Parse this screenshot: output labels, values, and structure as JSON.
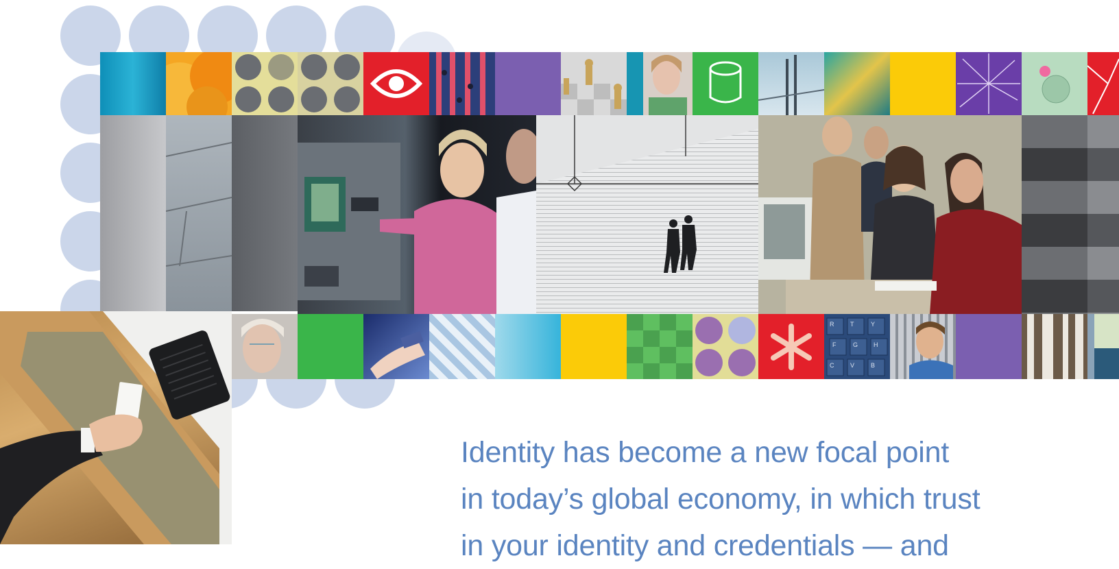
{
  "headline": {
    "line1": "Identity has become a new focal point",
    "line2": "in today’s global economy, in which trust",
    "line3": "in your identity and credentials — and"
  },
  "colors": {
    "headline": "#5a84c0",
    "dots": "#c9d4ea",
    "teal": "#1aa3c6",
    "orange": "#f39a1e",
    "red": "#e3202a",
    "purple": "#7b5fb0",
    "green": "#3ab54a",
    "yellow": "#fbcb08",
    "sky": "#5ec6e3",
    "gray": "#6e6f73"
  },
  "tiles": {
    "keyboard_keys": [
      "R",
      "T",
      "Y",
      "F",
      "G",
      "H",
      "C",
      "V",
      "B"
    ]
  }
}
